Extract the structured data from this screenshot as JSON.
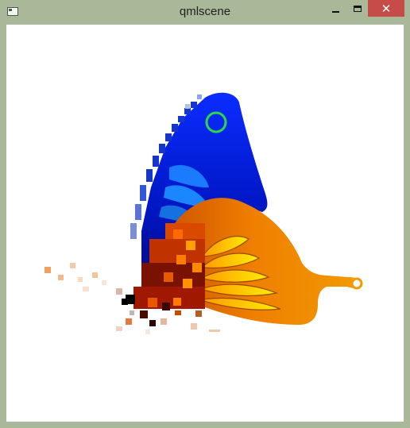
{
  "window": {
    "title": "qmlscene",
    "icon": "app-window-icon",
    "controls": {
      "minimize_icon": "minimize-icon",
      "maximize_icon": "maximize-icon",
      "close_icon": "close-icon",
      "close_label": "✕"
    },
    "frame_color": "#a8b898",
    "close_color": "#c74b46"
  },
  "scene": {
    "subject": "butterfly",
    "upper_wing_color": "#0018c8",
    "lower_wing_color": "#ee7c00",
    "highlight_ring_color": "#2fd64a"
  }
}
